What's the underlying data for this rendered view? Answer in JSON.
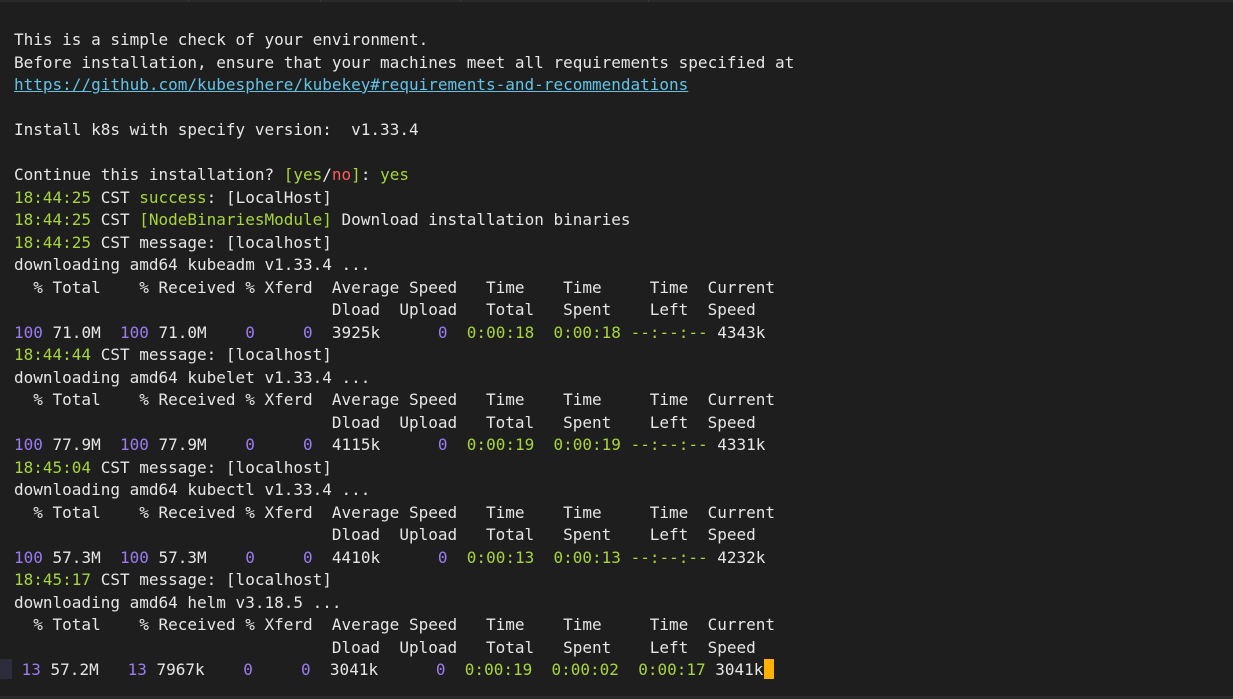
{
  "colors": {
    "background": "#1e1e1e",
    "text": "#e6e6e6",
    "link": "#62c3e6",
    "accent_green": "#a7d53a",
    "accent_red": "#ff5b5b",
    "accent_purple": "#9b7cf1",
    "cursor": "#ffb000"
  },
  "intro": {
    "line1": "This is a simple check of your environment.",
    "line2": "Before installation, ensure that your machines meet all requirements specified at",
    "link": "https://github.com/kubesphere/kubekey#requirements-and-recommendations"
  },
  "install": {
    "label": "Install k8s with specify version:  ",
    "version": "v1.33.4"
  },
  "prompt": {
    "text": "Continue this installation? ",
    "open": "[",
    "yes": "yes",
    "slash": "/",
    "no": "no",
    "close": "]",
    "colon": ": ",
    "answer": "yes"
  },
  "log": {
    "success": {
      "time": "18:44:25",
      "tz": " CST ",
      "status": "success",
      "rest": ": [LocalHost]"
    },
    "module": {
      "time": "18:44:25",
      "tz": " CST ",
      "bracket_open": "[",
      "name": "NodeBinariesModule",
      "bracket_close": "]",
      "message": " Download installation binaries"
    }
  },
  "curl_header": {
    "line1": "  % Total    % Received % Xferd  Average Speed   Time    Time     Time  Current",
    "line2": "                                 Dload  Upload   Total   Spent    Left  Speed"
  },
  "downloads": [
    {
      "msg_time": "18:44:25",
      "msg_tail": " CST message: [localhost]",
      "desc": "downloading amd64 kubeadm v1.33.4 ...",
      "pct1": "100",
      "total": " 71.0M  ",
      "pct2": "100",
      "received": " 71.0M    ",
      "xferd": "0",
      "xferd2": "0",
      "dload": "  3925k      ",
      "upload": "0",
      "time_total": "0:00:18",
      "time_spent": "0:00:18",
      "time_left": "--:--:--",
      "speed": " 4343k"
    },
    {
      "msg_time": "18:44:44",
      "msg_tail": " CST message: [localhost]",
      "desc": "downloading amd64 kubelet v1.33.4 ...",
      "pct1": "100",
      "total": " 77.9M  ",
      "pct2": "100",
      "received": " 77.9M    ",
      "xferd": "0",
      "xferd2": "0",
      "dload": "  4115k      ",
      "upload": "0",
      "time_total": "0:00:19",
      "time_spent": "0:00:19",
      "time_left": "--:--:--",
      "speed": " 4331k"
    },
    {
      "msg_time": "18:45:04",
      "msg_tail": " CST message: [localhost]",
      "desc": "downloading amd64 kubectl v1.33.4 ...",
      "pct1": "100",
      "total": " 57.3M  ",
      "pct2": "100",
      "received": " 57.3M    ",
      "xferd": "0",
      "xferd2": "0",
      "dload": "  4410k      ",
      "upload": "0",
      "time_total": "0:00:13",
      "time_spent": "0:00:13",
      "time_left": "--:--:--",
      "speed": " 4232k"
    },
    {
      "msg_time": "18:45:17",
      "msg_tail": " CST message: [localhost]",
      "desc": "downloading amd64 helm v3.18.5 ...",
      "pct1": " 13",
      "total": " 57.2M   ",
      "pct2": "13",
      "received": " 7967k    ",
      "xferd": "0",
      "xferd2": "0",
      "dload": "  3041k      ",
      "upload": "0",
      "time_total": "0:00:19",
      "time_spent": "0:00:02",
      "time_left": "0:00:17",
      "speed": " 3041k"
    }
  ]
}
